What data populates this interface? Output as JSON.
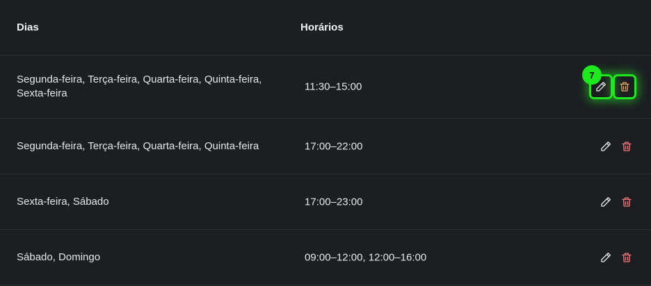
{
  "header": {
    "days_label": "Dias",
    "hours_label": "Horários"
  },
  "rows": [
    {
      "days": "Segunda-feira, Terça-feira, Quarta-feira, Quinta-feira, Sexta-feira",
      "hours": "11:30–15:00"
    },
    {
      "days": "Segunda-feira, Terça-feira, Quarta-feira, Quinta-feira",
      "hours": "17:00–22:00"
    },
    {
      "days": "Sexta-feira, Sábado",
      "hours": "17:00–23:00"
    },
    {
      "days": "Sábado, Domingo",
      "hours": "09:00–12:00, 12:00–16:00"
    }
  ],
  "highlight": {
    "badge": "7",
    "color": "#1ee81e"
  },
  "icons": {
    "edit": "pencil-icon",
    "delete": "trash-icon"
  },
  "colors": {
    "background": "#1c1e22",
    "delete_icon": "#f07b7b",
    "highlight": "#1ee81e"
  }
}
